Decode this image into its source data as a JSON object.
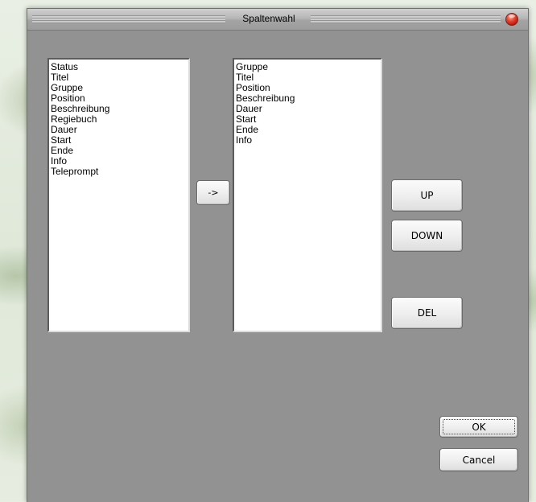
{
  "window": {
    "title": "Spaltenwahl"
  },
  "available_columns": {
    "items": [
      "Status",
      "Titel",
      "Gruppe",
      "Position",
      "Beschreibung",
      "Regiebuch",
      "Dauer",
      "Start",
      "Ende",
      "Info",
      "Teleprompt"
    ]
  },
  "selected_columns": {
    "items": [
      "Gruppe",
      "Titel",
      "Position",
      "Beschreibung",
      "Dauer",
      "Start",
      "Ende",
      "Info"
    ]
  },
  "buttons": {
    "add": "->",
    "up": "UP",
    "down": "DOWN",
    "del": "DEL",
    "ok": "OK",
    "cancel": "Cancel"
  },
  "icons": {
    "close": "close-icon"
  },
  "colors": {
    "window_background": "#929292",
    "close_button": "#d0281a"
  }
}
